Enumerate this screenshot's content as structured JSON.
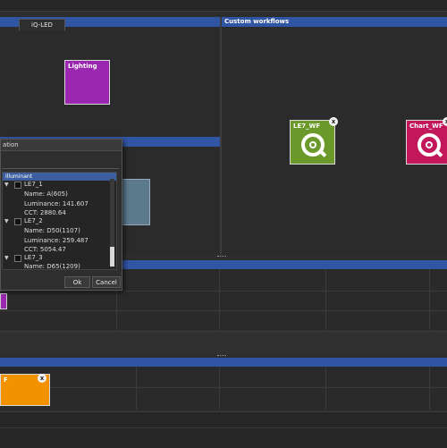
{
  "panels": {
    "custom_workflows_title": "Custom workflows"
  },
  "tiles": {
    "lighting": {
      "label": "Lighting",
      "color": "#9b27b0"
    },
    "le7_wf": {
      "label": "LE7_WF",
      "color": "#6c9a2a",
      "close": "x"
    },
    "chart_wf": {
      "label": "Chart_WF",
      "color": "#c2185b",
      "close": "x"
    },
    "orange_wf": {
      "label": "F",
      "color": "#f39200",
      "close": "x"
    }
  },
  "dialog": {
    "title": "ation",
    "tab_label": "iQ-LED",
    "tree_header": "Illuminant",
    "rows": [
      {
        "kind": "node",
        "label": "LE7_1"
      },
      {
        "kind": "prop",
        "label": "Name: A(605)"
      },
      {
        "kind": "prop",
        "label": "Luminance: 141.607"
      },
      {
        "kind": "prop",
        "label": "CCT: 2880.64"
      },
      {
        "kind": "node",
        "label": "LE7_2"
      },
      {
        "kind": "prop",
        "label": "Name: D50(1107)"
      },
      {
        "kind": "prop",
        "label": "Luminance: 259.487"
      },
      {
        "kind": "prop",
        "label": "CCT: 5054.47"
      },
      {
        "kind": "node",
        "label": "LE7_3"
      },
      {
        "kind": "prop",
        "label": "Name: D65(1209)"
      }
    ],
    "ok_label": "Ok",
    "cancel_label": "Cancel"
  },
  "colors": {
    "header_blue": "#3155a5",
    "background": "#2d2d2d"
  }
}
